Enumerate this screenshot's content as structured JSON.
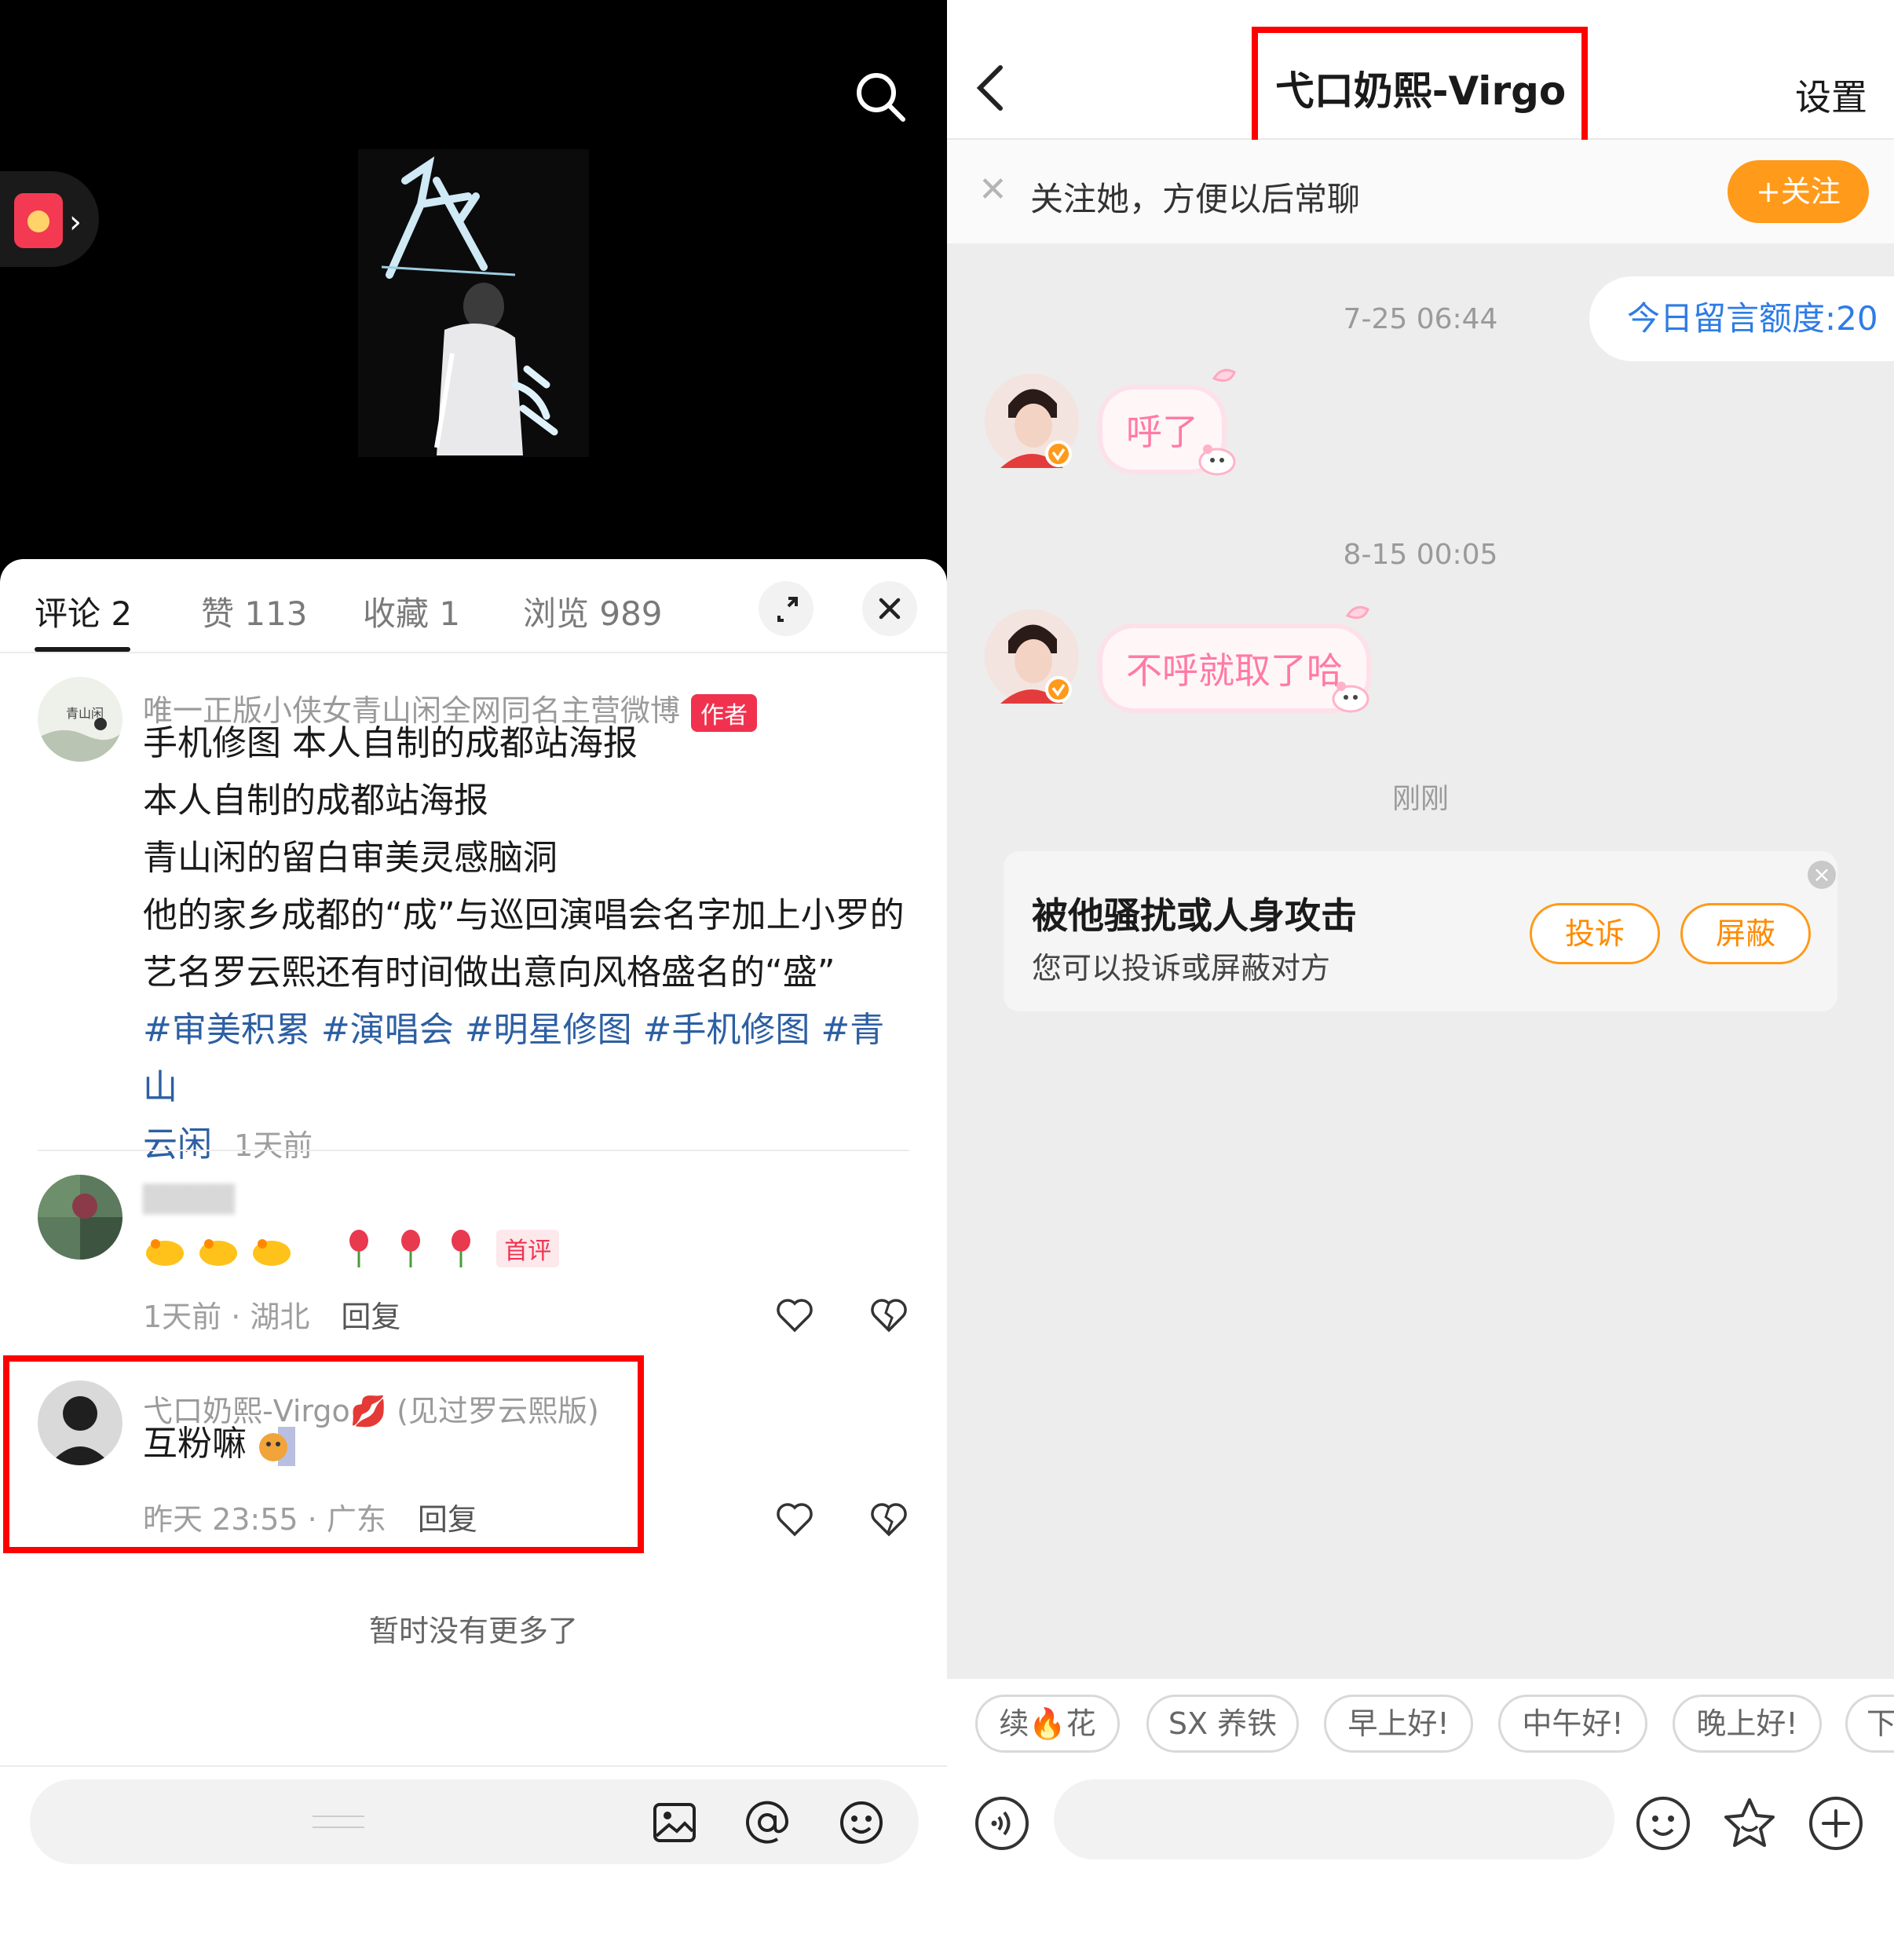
{
  "left": {
    "tabs": [
      {
        "label": "评论 2"
      },
      {
        "label": "赞 113"
      },
      {
        "label": "收藏 1"
      },
      {
        "label": "浏览 989"
      }
    ],
    "comments": [
      {
        "name": "唯一正版小侠女青山闲全网同名主营微博",
        "badge": "作者",
        "lines": [
          "手机修图 本人自制的成都站海报",
          "本人自制的成都站海报",
          "青山闲的留白审美灵感脑洞",
          "他的家乡成都的“成”与巡回演唱会名字加上小罗的",
          "艺名罗云熙还有时间做出意向风格盛名的“盛”"
        ],
        "tags_line1": "#审美积累 #演唱会 #明星修图 #手机修图 #青山",
        "tags_line2": "云闲",
        "time": "1天前"
      },
      {
        "badge": "首评",
        "meta": "1天前 · 湖北",
        "reply": "回复"
      },
      {
        "name": "弋口奶熙-Virgo💋 (见过罗云熙版)",
        "text": "互粉嘛",
        "meta": "昨天 23:55 · 广东",
        "reply": "回复"
      }
    ],
    "no_more": "暂时没有更多了"
  },
  "right": {
    "title": "弋口奶熙-Virgo",
    "settings": "设置",
    "follow_prompt": "关注她，方便以后常聊",
    "follow_button": "+关注",
    "quota": "今日留言额度:20",
    "messages": [
      {
        "time": "7-25 06:44",
        "text": "呼了"
      },
      {
        "time": "8-15 00:05",
        "text": "不呼就取了哈"
      }
    ],
    "just_now": "刚刚",
    "report": {
      "heading": "被他骚扰或人身攻击",
      "sub": "您可以投诉或屏蔽对方",
      "complain": "投诉",
      "block": "屏蔽"
    },
    "quick_replies": [
      "续🔥花",
      "SX 养铁",
      "早上好!",
      "中午好!",
      "晚上好!",
      "下"
    ]
  },
  "colors": {
    "brand_red": "#f0324f",
    "follow_orange": "#ff9a1a",
    "highlight_box": "#ff0000",
    "hashtag_blue": "#2d5fa3",
    "quota_blue": "#2e7ce6",
    "bubble_pink": "#ff7aa6"
  },
  "icons": [
    "search-icon",
    "red-packet-icon",
    "expand-icon",
    "close-icon",
    "heart-icon",
    "dislike-heart-icon",
    "image-icon",
    "at-icon",
    "emoji-icon",
    "back-icon",
    "voice-icon",
    "sticker-icon",
    "plus-icon"
  ]
}
